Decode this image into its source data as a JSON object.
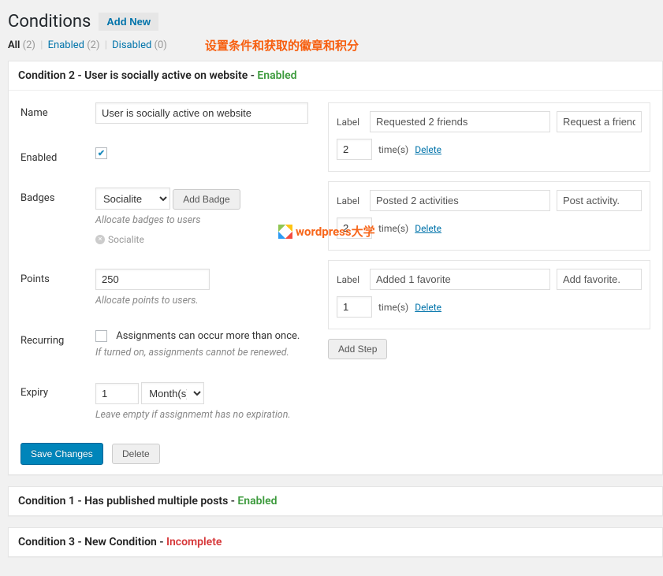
{
  "header": {
    "title": "Conditions",
    "add_new": "Add New",
    "overlay": "设置条件和获取的徽章和积分"
  },
  "tabs": {
    "all": {
      "label": "All",
      "count": "(2)"
    },
    "enabled": {
      "label": "Enabled",
      "count": "(2)"
    },
    "disabled": {
      "label": "Disabled",
      "count": "(0)"
    }
  },
  "condition2": {
    "title_prefix": "Condition 2 - ",
    "title_name": "User is socially active on website",
    "status": "Enabled",
    "fields": {
      "name_label": "Name",
      "name_value": "User is socially active on website",
      "enabled_label": "Enabled",
      "badges_label": "Badges",
      "badge_select_value": "Socialite",
      "add_badge_btn": "Add Badge",
      "badges_help": "Allocate badges to users",
      "badge_tag": "Socialite",
      "points_label": "Points",
      "points_value": "250",
      "points_help": "Allocate points to users.",
      "recurring_label": "Recurring",
      "recurring_text": "Assignments can occur more than once.",
      "recurring_help": "If turned on, assignments cannot be renewed.",
      "expiry_label": "Expiry",
      "expiry_num": "1",
      "expiry_period": "Month(s)",
      "expiry_help": "Leave empty if assignmemt has no expiration."
    },
    "steps": [
      {
        "label_text": "Requested 2 friends",
        "action_text": "Request a friend.",
        "times": "2"
      },
      {
        "label_text": "Posted 2 activities",
        "action_text": "Post activity.",
        "times": "2"
      },
      {
        "label_text": "Added 1 favorite",
        "action_text": "Add favorite.",
        "times": "1"
      }
    ],
    "step_ui": {
      "label_word": "Label",
      "times_word": "time(s)",
      "delete_word": "Delete",
      "add_step_btn": "Add Step"
    },
    "footer": {
      "save": "Save Changes",
      "delete": "Delete"
    }
  },
  "condition1": {
    "title_prefix": "Condition 1 - ",
    "title_name": "Has published multiple posts",
    "status": "Enabled"
  },
  "condition3": {
    "title_prefix": "Condition 3 - ",
    "title_name": "New Condition",
    "status": "Incomplete"
  },
  "watermark": "wordpress大学"
}
